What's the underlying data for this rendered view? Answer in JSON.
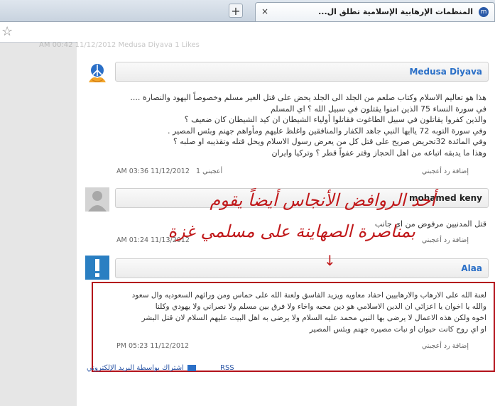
{
  "browser": {
    "tab_title": "المنظمات الإرهابية الإسلامية تطلق ال...",
    "tab_favicon": "m",
    "new_tab": "+",
    "close": "×"
  },
  "faded_meta": "AM 00:42 11/12/2012   Medusa Diyava   1 Likes",
  "comments": [
    {
      "author": "Medusa Diyava",
      "author_color": "#2a6fc7",
      "lines": [
        "هذا هو تعاليم الاسلام  وكتاب صلعم من الجلد الى الجلد يحض على قتل الغير مسلم وخصوصاً اليهود والنصارة ....",
        "في سورة النساء 75 الذين امنوا يقتلون في سبيل الله ؟ اي المسلم",
        "والذين كفروا يقاتلون في سبيل الطاغوت فقاتلوا أولياء الشيطان ان كيد الشيطان  كان ضعيف ؟",
        "وفي سورة التوبه 72 ياايها النبي جاهد الكفار والمنافقين واغلظ عليهم ومأواهم جهنم وبئس المصير .",
        "وفي المائدة  32تحريض صريح  على قتل كل من يعرض رسول الاسلام ويحل قتله وتقذيبه او صلبه ؟",
        "وهذا ما يدبقه اتباعه من اهل الحجاز وقتر عفواً قطر ؟ وتركيا وايران"
      ],
      "date": "AM 03:36 11/12/2012",
      "likes": "1 أعجبني",
      "actions": "إضافة رد    أعجبني"
    },
    {
      "author": "mohamed keny",
      "author_color": "#222222",
      "lines": [
        "قتل المدنيين مرفوض من اي جانب"
      ],
      "date": "AM 01:24 11/13/2012",
      "likes": "",
      "actions": "إضافة رد    أعجبني"
    },
    {
      "author": "Alaa",
      "author_color": "#2a6fc7",
      "lines": [
        "لعنة الله على الارهاب والارهابيين احفاد معاويه ويزيد الفاسق ولعنة الله على حماس ومن ورائهم السعوديه وال سعود",
        "والله يا اخوان يا اعزائي ان الدين الاسلامي هو دين محبه واخاء ولا فرق بين مسلم ولا نصراني ولا يهودي وكلنا",
        "اخوه ولكن هذه الاعمال لا يرضى بها النبي محمد عليه السلام ولا يرضى به اهل البيت عليهم السلام لان قتل البشر",
        "او اي روح كانت حيوان او نبات مصيره جهنم وبئس المصير"
      ],
      "date": "PM 05:23 11/12/2012",
      "likes": "",
      "actions": "إضافة رد    أعجبني"
    }
  ],
  "overlay": {
    "line1": "أحد الروافض الأنجاس أيضاً يقوم",
    "line2": "بمناصرة الصهاينة على مسلمي غزة",
    "arrow": "↓"
  },
  "footer": {
    "subscribe_email": "اشتراك بواسطة البريد الإلكتروني",
    "rss": "RSS"
  }
}
